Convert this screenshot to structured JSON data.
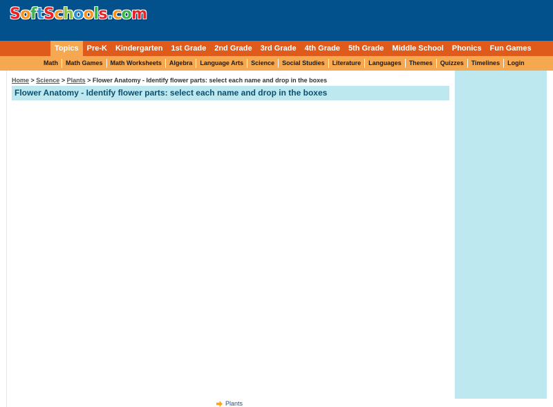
{
  "logo": {
    "letters": [
      {
        "ch": "S",
        "color": "#e8242a"
      },
      {
        "ch": "o",
        "color": "#f7931e"
      },
      {
        "ch": "f",
        "color": "#39b54a"
      },
      {
        "ch": "t",
        "color": "#2e8fd8"
      },
      {
        "ch": "S",
        "color": "#e8242a"
      },
      {
        "ch": "c",
        "color": "#f7931e"
      },
      {
        "ch": "h",
        "color": "#8cc63f"
      },
      {
        "ch": "o",
        "color": "#2e8fd8"
      },
      {
        "ch": "o",
        "color": "#f7931e"
      },
      {
        "ch": "l",
        "color": "#39b54a"
      },
      {
        "ch": "s",
        "color": "#e8242a"
      },
      {
        "ch": ".",
        "color": "#2e8fd8"
      },
      {
        "ch": "c",
        "color": "#f7931e"
      },
      {
        "ch": "o",
        "color": "#39b54a"
      },
      {
        "ch": "m",
        "color": "#e8242a"
      }
    ]
  },
  "nav_primary": [
    "Topics",
    "Pre-K",
    "Kindergarten",
    "1st Grade",
    "2nd Grade",
    "3rd Grade",
    "4th Grade",
    "5th Grade",
    "Middle School",
    "Phonics",
    "Fun Games"
  ],
  "nav_secondary": [
    "Math",
    "Math Games",
    "Math Worksheets",
    "Algebra",
    "Language Arts",
    "Science",
    "Social Studies",
    "Literature",
    "Languages",
    "Themes",
    "Quizzes",
    "Timelines",
    "Login"
  ],
  "breadcrumb": {
    "home": "Home",
    "sep1": " > ",
    "science": "Science",
    "sep2": " > ",
    "plants": "Plants",
    "sep3": " > ",
    "current": "Flower Anatomy - Identify flower parts: select each name and drop in the boxes"
  },
  "page_title": "Flower Anatomy - Identify flower parts: select each name and drop in the boxes",
  "bottom_link": "Plants",
  "colors": {
    "header_bg": "#02508c",
    "nav_primary_bg": "#de5b1b",
    "nav_secondary_bg": "#f5a850",
    "sidebar_bg": "#bde8ef",
    "title_text": "#0b4f6c",
    "arrow_icon": "#f5a623"
  }
}
